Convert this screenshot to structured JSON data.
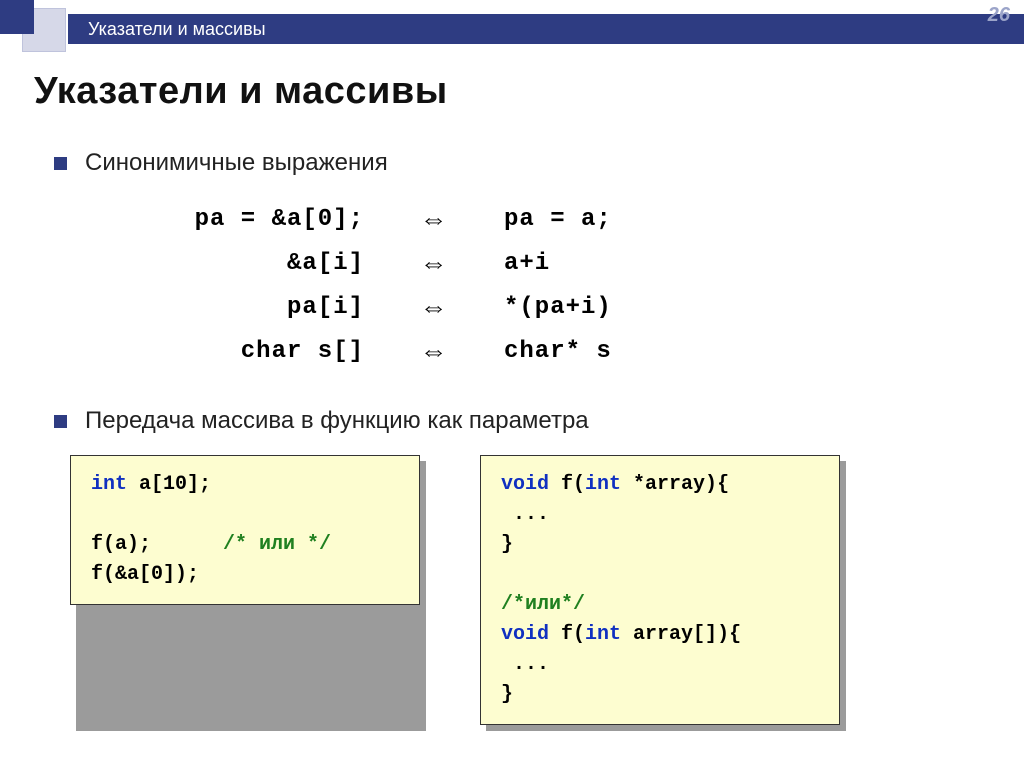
{
  "page_number": "26",
  "topbar_title": "Указатели и массивы",
  "heading": "Указатели и массивы",
  "bullet1": "Синонимичные выражения",
  "bullet2": "Передача массива в функцию как параметра",
  "equiv": [
    {
      "left": "pa = &a[0];",
      "right": "pa = a;"
    },
    {
      "left": "&a[i]",
      "right": "a+i"
    },
    {
      "left": "pa[i]",
      "right": "*(pa+i)"
    },
    {
      "left": "char s[]",
      "right": "char* s"
    }
  ],
  "arrow": "⇔",
  "code1": {
    "kw_int": "int",
    "decl_rest": " a[10];",
    "blank": "",
    "call1_pre": "f(a);      ",
    "comment1": "/* или */",
    "call2": "f(&a[0]);"
  },
  "code2": {
    "kw_void1": "void",
    "sig1_rest": " f(",
    "kw_int1": "int",
    "sig1_tail": " *array){",
    "dots": " ...",
    "close": "}",
    "blank": "",
    "comment_or": "/*или*/",
    "kw_void2": "void",
    "sig2_rest": " f(",
    "kw_int2": "int",
    "sig2_tail": " array[]){"
  }
}
